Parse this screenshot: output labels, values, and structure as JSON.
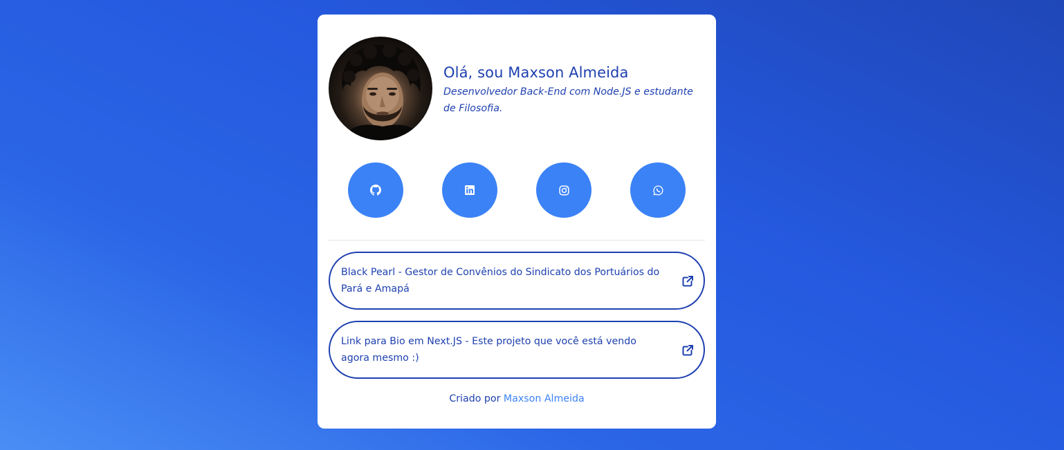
{
  "profile": {
    "name": "Olá, sou Maxson Almeida",
    "bio": "Desenvolvedor Back-End com Node.JS e estudante de Filosofia.",
    "avatar_alt": "Maxson Almeida"
  },
  "socials": [
    {
      "name": "GitHub",
      "icon": "github-icon"
    },
    {
      "name": "LinkedIn",
      "icon": "linkedin-icon"
    },
    {
      "name": "Instagram",
      "icon": "instagram-icon"
    },
    {
      "name": "WhatsApp",
      "icon": "whatsapp-icon"
    }
  ],
  "links": [
    {
      "label": "Black Pearl - Gestor de Convênios do Sindicato dos Portuários do Pará e Amapá",
      "icon": "external-link-icon"
    },
    {
      "label": "Link para Bio em Next.JS - Este projeto que você está vendo agora mesmo :)",
      "icon": "external-link-icon"
    }
  ],
  "footer": {
    "prefix": "Criado por",
    "author": "Maxson Almeida"
  },
  "colors": {
    "primary": "#1e40af",
    "accent": "#3b82f6",
    "card": "#ffffff"
  }
}
